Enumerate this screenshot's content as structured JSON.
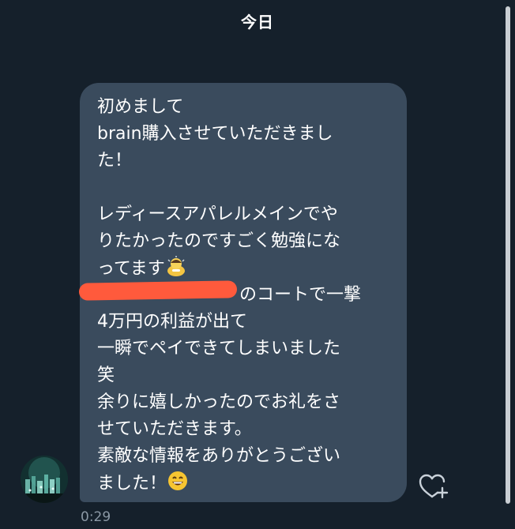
{
  "date_divider": "今日",
  "message": {
    "lines": [
      "初めまして",
      "brain購入させていただきまし",
      "た！",
      "",
      " レディースアパレルメインでや",
      "りたかったのですごく勉強にな",
      "ってます",
      "のコートで一撃",
      "4万円の利益が出て",
      "一瞬でペイできてしまいました",
      "笑",
      "余りに嬉しかったのでお礼をさ",
      "せていただきます。",
      "素敵な情報をありがとうござい",
      "ました！"
    ],
    "emojis": {
      "line7": "person-bowing-emoji",
      "line15": "grinning-face-emoji"
    },
    "timestamp": "0:29",
    "redaction_color": "#ff5a3c"
  },
  "colors": {
    "background": "#15202b",
    "bubble": "#3a4b5d",
    "timestamp": "#8b98a5"
  },
  "icons": {
    "react": "heart-plus-icon"
  }
}
